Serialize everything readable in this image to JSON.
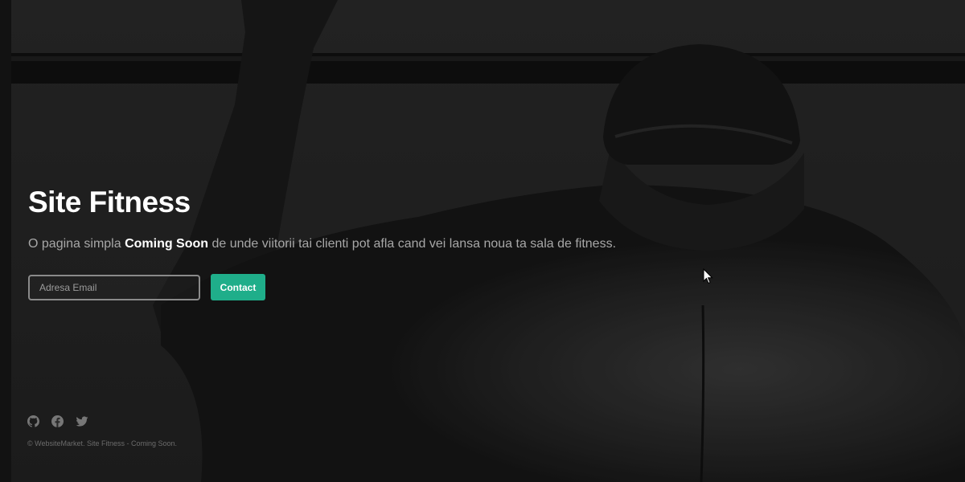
{
  "hero": {
    "title": "Site Fitness",
    "subtitle_before": "O pagina simpla ",
    "subtitle_bold": "Coming Soon",
    "subtitle_after": " de unde viitorii tai clienti pot afla cand vei lansa noua ta sala de fitness."
  },
  "form": {
    "email_placeholder": "Adresa Email",
    "contact_label": "Contact"
  },
  "footer": {
    "social_icons": [
      "github-icon",
      "facebook-icon",
      "twitter-icon"
    ],
    "copyright": "© WebsiteMarket. Site Fitness - Coming Soon."
  },
  "colors": {
    "accent": "#1fae8a",
    "title": "#ffffff",
    "subtitle": "#a7a7a7"
  }
}
